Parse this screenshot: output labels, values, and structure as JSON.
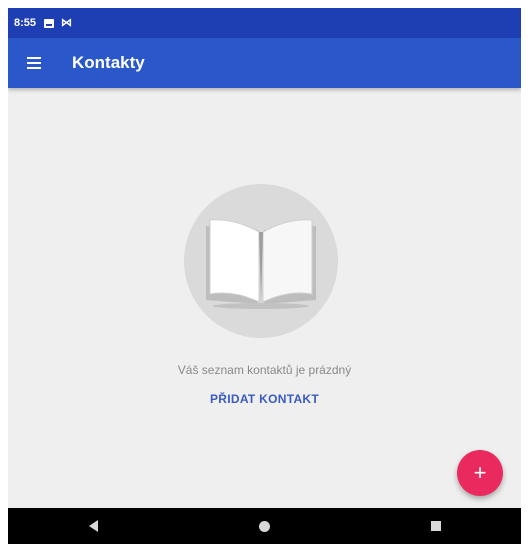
{
  "status_bar": {
    "time": "8:55",
    "icons": [
      "image-icon",
      "mail-icon"
    ]
  },
  "app_bar": {
    "title": "Kontakty",
    "menu_icon": "hamburger-menu-icon"
  },
  "empty_state": {
    "illustration": "open-book-icon",
    "message": "Váš seznam kontaktů je prázdný",
    "action_label": "PŘIDAT KONTAKT"
  },
  "fab": {
    "label": "+",
    "color": "#ea2a5e"
  },
  "nav_bar": {
    "buttons": [
      "back-icon",
      "home-icon",
      "recents-icon"
    ]
  },
  "colors": {
    "status_bar": "#1d3fb3",
    "app_bar": "#2a57c9",
    "background": "#efefef",
    "accent": "#3a5bbf"
  }
}
